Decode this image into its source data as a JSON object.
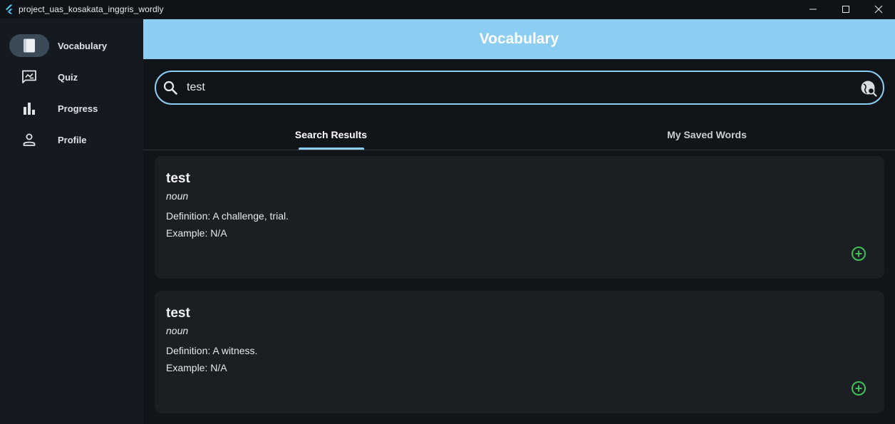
{
  "window": {
    "title": "project_uas_kosakata_inggris_wordly"
  },
  "sidebar": {
    "items": [
      {
        "label": "Vocabulary",
        "icon": "book-icon",
        "active": true
      },
      {
        "label": "Quiz",
        "icon": "quiz-icon",
        "active": false
      },
      {
        "label": "Progress",
        "icon": "bar-chart-icon",
        "active": false
      },
      {
        "label": "Profile",
        "icon": "person-icon",
        "active": false
      }
    ]
  },
  "appbar": {
    "title": "Vocabulary"
  },
  "search": {
    "value": "test",
    "icon": "search-icon",
    "action_icon": "web-search-icon"
  },
  "tabs": [
    {
      "label": "Search Results",
      "active": true
    },
    {
      "label": "My Saved Words",
      "active": false
    }
  ],
  "results": [
    {
      "word": "test",
      "part_of_speech": "noun",
      "definition": "Definition: A challenge, trial.",
      "example": "Example: N/A",
      "action_icon": "add-circle-icon"
    },
    {
      "word": "test",
      "part_of_speech": "noun",
      "definition": "Definition: A witness.",
      "example": "Example: N/A",
      "action_icon": "add-circle-icon"
    }
  ],
  "colors": {
    "accent": "#8ccdf2",
    "add_icon": "#3fbf5a",
    "card_bg": "#1b1f23",
    "main_bg": "#111519"
  }
}
